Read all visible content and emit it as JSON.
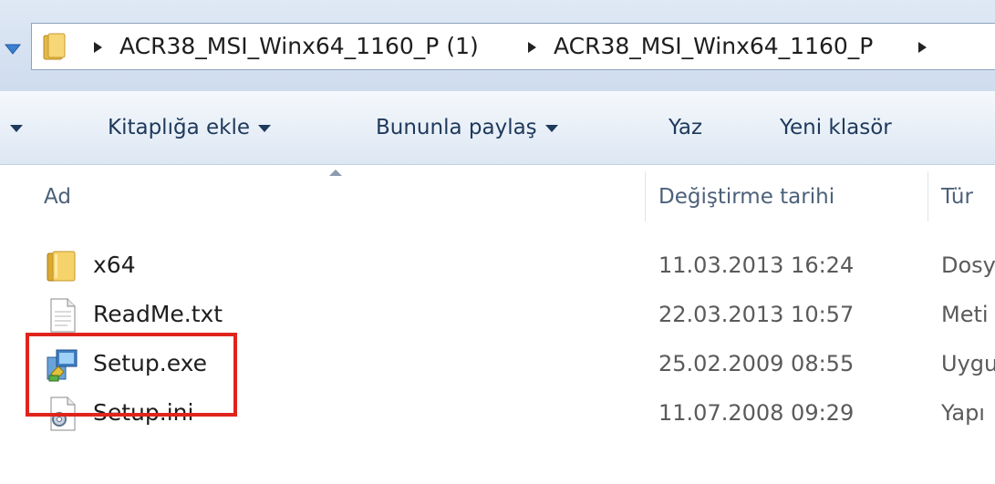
{
  "address_bar": {
    "crumbs": [
      "ACR38_MSI_Winx64_1160_P (1)",
      "ACR38_MSI_Winx64_1160_P"
    ]
  },
  "toolbar": {
    "add_to_library": "Kitaplığa ekle",
    "share_with": "Bununla paylaş",
    "burn": "Yaz",
    "new_folder": "Yeni klasör"
  },
  "columns": {
    "name": "Ad",
    "date_modified": "Değiştirme tarihi",
    "type": "Tür"
  },
  "files": [
    {
      "name": "x64",
      "date": "11.03.2013 16:24",
      "type": "Dosy",
      "icon": "folder-icon"
    },
    {
      "name": "ReadMe.txt",
      "date": "22.03.2013 10:57",
      "type": "Meti",
      "icon": "text-file-icon"
    },
    {
      "name": "Setup.exe",
      "date": "25.02.2009 08:55",
      "type": "Uygu",
      "icon": "setup-exe-icon"
    },
    {
      "name": "Setup.ini",
      "date": "11.07.2008 09:29",
      "type": "Yapı",
      "icon": "ini-file-icon"
    }
  ],
  "colors": {
    "highlight": "#e0241c",
    "toolbar_text": "#1e395b",
    "header_text": "#4c607a"
  }
}
